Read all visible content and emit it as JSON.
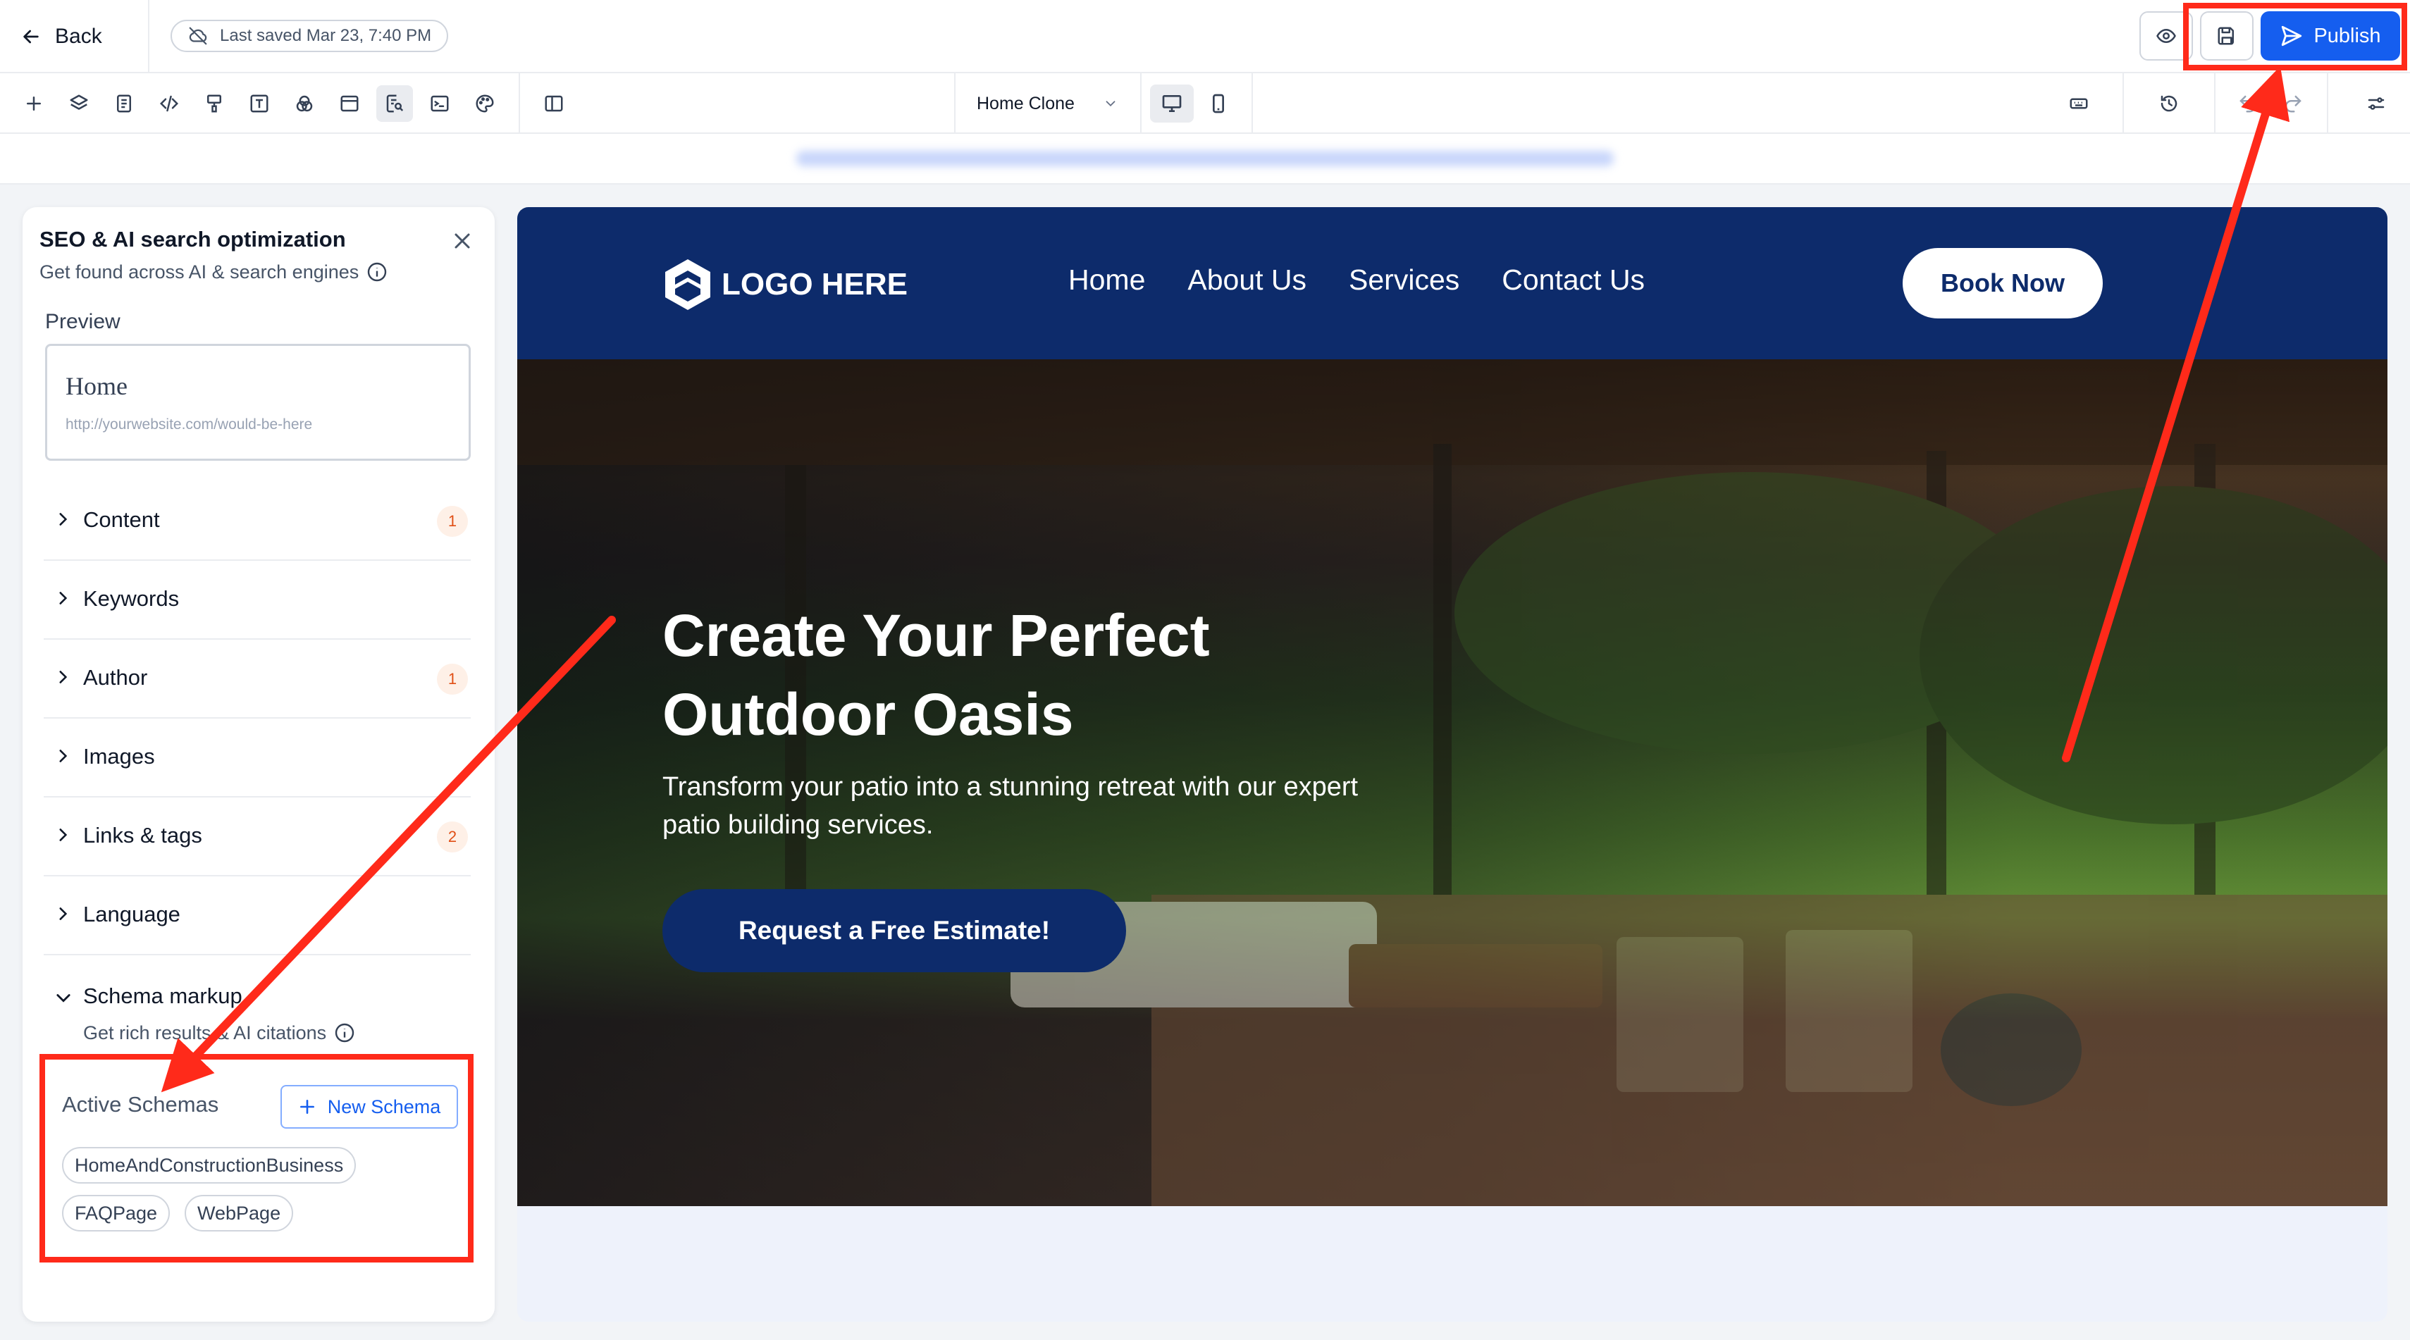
{
  "topbar": {
    "back_label": "Back",
    "saved_text": "Last saved Mar 23, 7:40 PM",
    "publish_label": "Publish"
  },
  "toolbar": {
    "page_name": "Home Clone"
  },
  "panel": {
    "title": "SEO & AI search optimization",
    "subtitle": "Get found across AI & search engines",
    "preview_label": "Preview",
    "preview_title": "Home",
    "preview_url": "http://yourwebsite.com/would-be-here",
    "sections": [
      {
        "label": "Content",
        "badge": "1"
      },
      {
        "label": "Keywords",
        "badge": ""
      },
      {
        "label": "Author",
        "badge": "1"
      },
      {
        "label": "Images",
        "badge": ""
      },
      {
        "label": "Links & tags",
        "badge": "2"
      },
      {
        "label": "Language",
        "badge": ""
      }
    ],
    "schema": {
      "label": "Schema markup",
      "subtitle": "Get rich results & AI citations",
      "active_title": "Active Schemas",
      "new_button": "New Schema",
      "chips": [
        "HomeAndConstructionBusiness",
        "FAQPage",
        "WebPage"
      ]
    }
  },
  "site": {
    "logo_text": "LOGO HERE",
    "nav": [
      "Home",
      "About Us",
      "Services",
      "Contact Us"
    ],
    "book_button": "Book Now",
    "hero_title": "Create Your Perfect Outdoor Oasis",
    "hero_text": "Transform your patio into a stunning retreat with our expert patio building services.",
    "hero_button": "Request a Free Estimate!"
  },
  "colors": {
    "accent": "#155eef",
    "site_navy": "#0d2b6b",
    "annotation_red": "#ff2a1a",
    "badge_bg": "#fef0e7",
    "badge_text": "#e04f16"
  },
  "icons": {
    "toolbar": [
      "plus-icon",
      "layers-icon",
      "page-icon",
      "code-icon",
      "brush-icon",
      "text-icon",
      "shapes-icon",
      "layout-icon",
      "seo-search-icon",
      "terminal-icon",
      "palette-icon",
      "split-view-icon"
    ]
  }
}
